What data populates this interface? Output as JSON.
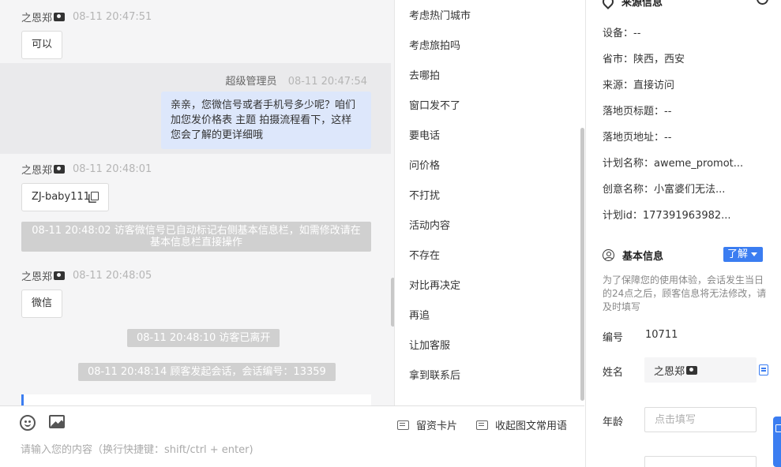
{
  "chat": {
    "messages": [
      {
        "sender": "之恩郑",
        "time": "08-11 20:47:51",
        "text": "可以"
      },
      {
        "sender": "之恩郑",
        "time": "08-11 20:48:01",
        "text": "ZJ-baby111"
      },
      {
        "sender": "之恩郑",
        "time": "08-11 20:48:05",
        "text": "微信"
      }
    ],
    "agent_message": {
      "sender": "超级管理员",
      "time": "08-11 20:47:54",
      "text": "亲亲，您微信号或者手机号多少呢？咱们加您发价格表 主题 拍摄流程看下，这样您会了解的更详细哦"
    },
    "system_notices": [
      "08-11 20:48:02 访客微信号已自动标记右侧基本信息栏，如需修改请在基本信息栏直接操作",
      "08-11 20:48:10 访客已离开",
      "08-11 20:48:14 顾客发起会话，会话编号：13359"
    ]
  },
  "composer": {
    "placeholder": "请输入您的内容（换行快捷键：shift/ctrl + enter)",
    "card_label": "留资卡片",
    "phrase_label": "收起图文常用语"
  },
  "quick_replies": [
    "考虑热门城市",
    "考虑旅拍吗",
    "去哪拍",
    "窗口发不了",
    "要电话",
    "问价格",
    "不打扰",
    "活动内容",
    "不存在",
    "对比再决定",
    "再追",
    "让加客服",
    "拿到联系后"
  ],
  "info": {
    "source_title": "来源信息",
    "source_rows": [
      {
        "label": "设备：",
        "value": "--"
      },
      {
        "label": "省市：",
        "value": "陕西，西安"
      },
      {
        "label": "来源：",
        "value": "直接访问"
      },
      {
        "label": "落地页标题：",
        "value": "--"
      },
      {
        "label": "落地页地址：",
        "value": "--"
      },
      {
        "label": "计划名称：",
        "value": "aweme_promot..."
      },
      {
        "label": "创意名称：",
        "value": "小富婆们无法..."
      },
      {
        "label": "计划id：",
        "value": "177391963982..."
      }
    ],
    "basic_title": "基本信息",
    "know_label": "了解",
    "note": "为了保障您的使用体验，会话发生当日的24点之后，顾客信息将无法修改，请及时填写",
    "id_label": "编号",
    "id_value": "10711",
    "name_label": "姓名",
    "name_value": "之恩郑",
    "age_label": "年龄",
    "age_placeholder": "点击填写"
  }
}
